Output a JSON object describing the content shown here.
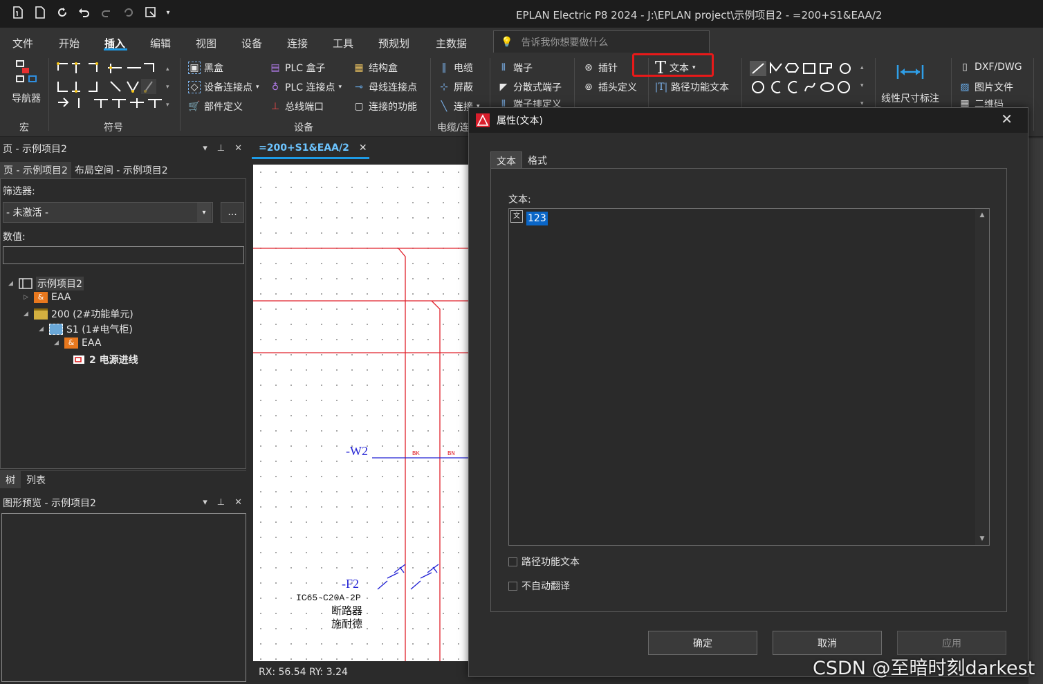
{
  "window": {
    "title": "EPLAN Electric P8 2024 - J:\\EPLAN project\\示例项目2 - =200+S1&EAA/2"
  },
  "menu": {
    "tabs": [
      "文件",
      "开始",
      "插入",
      "编辑",
      "视图",
      "设备",
      "连接",
      "工具",
      "预规划",
      "主数据"
    ],
    "active": "插入"
  },
  "search": {
    "placeholder": "告诉我你想要做什么"
  },
  "ribbon": {
    "navigator": "导航器",
    "groups": {
      "macro": "宏",
      "symbol": "符号",
      "device": "设备",
      "cable": "电缆/连"
    },
    "device_items": [
      "黑盒",
      "设备连接点",
      "部件定义",
      "PLC 盒子",
      "PLC 连接点",
      "总线端口",
      "结构盒",
      "母线连接点",
      "连接的功能"
    ],
    "cable_items": [
      "电缆",
      "屏蔽",
      "连接"
    ],
    "terminal_items": [
      "端子",
      "分散式端子",
      "端子排定义"
    ],
    "plug_items": [
      "插针",
      "插头定义"
    ],
    "text_items": [
      "文本",
      "路径功能文本"
    ],
    "dimension": "线性尺寸标注",
    "import_items": [
      "DXF/DWG",
      "图片文件",
      "二维码"
    ]
  },
  "pagepanel": {
    "title": "页 - 示例项目2",
    "tabs": [
      "页 - 示例项目2",
      "布局空间 - 示例项目2"
    ],
    "filter_label": "筛选器:",
    "filter_value": "- 未激活 -",
    "filter_more": "...",
    "value_label": "数值:",
    "tree": [
      "示例项目2",
      "EAA",
      "200 (2#功能单元)",
      "S1 (1#电气柜)",
      "EAA",
      "2 电源进线"
    ],
    "bottom_tabs": [
      "树",
      "列表"
    ]
  },
  "previewpanel": {
    "title": "图形预览 - 示例项目2"
  },
  "document": {
    "tab": "=200+S1&EAA/2"
  },
  "schematic": {
    "cable": "-W2",
    "wire1": "BK",
    "wire2": "BN",
    "breaker": "-F2",
    "breaker_type": "IC65-C20A-2P",
    "breaker_name": "断路器",
    "breaker_maker": "施耐德"
  },
  "status": {
    "coords": "RX: 56.54 RY: 3.24"
  },
  "dialog": {
    "title": "属性(文本)",
    "tabs": [
      "文本",
      "格式"
    ],
    "text_label": "文本:",
    "text_value": "123",
    "checkbox1": "路径功能文本",
    "checkbox2": "不自动翻译",
    "ok": "确定",
    "cancel": "取消",
    "apply": "应用"
  },
  "watermark": "CSDN @至暗时刻darkest",
  "colors": {
    "accent": "#1e9be6",
    "highlight": "#e81919",
    "schematic_red": "#e0202a",
    "schematic_blue": "#2323d4"
  }
}
